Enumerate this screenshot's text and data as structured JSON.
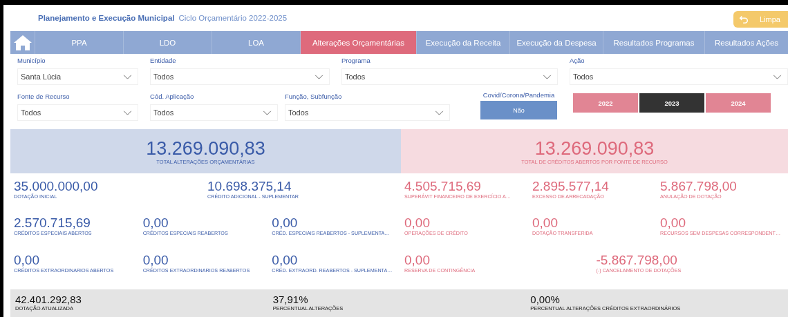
{
  "header": {
    "title": "Planejamento e Execução Municipal",
    "subtitle": "Ciclo Orçamentário 2022-2025",
    "reset_button": "Limpa"
  },
  "tabs": [
    {
      "label": "PPA",
      "selected": false
    },
    {
      "label": "LDO",
      "selected": false
    },
    {
      "label": "LOA",
      "selected": false
    },
    {
      "label": "Alterações Orçamentárias",
      "selected": true
    },
    {
      "label": "Execução da Receita",
      "selected": false
    },
    {
      "label": "Execução da Despesa",
      "selected": false
    },
    {
      "label": "Resultados Programas",
      "selected": false
    },
    {
      "label": "Resultados Ações",
      "selected": false
    }
  ],
  "filters_row1": [
    {
      "label": "Município",
      "value": "Santa Lúcia"
    },
    {
      "label": "Entidade",
      "value": "Todos"
    },
    {
      "label": "Programa",
      "value": "Todos"
    },
    {
      "label": "Ação",
      "value": "Todos"
    }
  ],
  "filters_row2": [
    {
      "label": "Fonte de Recurso",
      "value": "Todos"
    },
    {
      "label": "Cód. Aplicação",
      "value": "Todos"
    },
    {
      "label": "Função, Subfunção",
      "value": "Todos"
    }
  ],
  "covid": {
    "label": "Covid/Corona/Pandemia",
    "value": "Não"
  },
  "years": [
    {
      "label": "2022",
      "selected": false
    },
    {
      "label": "2023",
      "selected": true
    },
    {
      "label": "2024",
      "selected": false
    }
  ],
  "totals": [
    {
      "value": "13.269.090,83",
      "label": "TOTAL ALTERAÇÕES ORÇAMENTÁRIAS"
    },
    {
      "value": "13.269.090,83",
      "label": "TOTAL DE CRÉDITOS ABERTOS POR FONTE DE RECURSO"
    }
  ],
  "left_rows": [
    [
      {
        "value": "35.000.000,00",
        "label": "DOTAÇÃO INICIAL"
      },
      {
        "value": "10.698.375,14",
        "label": "CRÉDITO ADICIONAL - SUPLEMENTAR"
      }
    ],
    [
      {
        "value": "2.570.715,69",
        "label": "CRÉDITOS ESPECIAIS ABERTOS"
      },
      {
        "value": "0,00",
        "label": "CRÉDITOS ESPECIAIS REABERTOS"
      },
      {
        "value": "0,00",
        "label": "CRÉD. ESPECIAIS REABERTOS - SUPLEMENTA…"
      }
    ],
    [
      {
        "value": "0,00",
        "label": "CRÉDITOS EXTRAORDINARIOS ABERTOS"
      },
      {
        "value": "0,00",
        "label": "CRÉDITOS EXTRAORDINARIOS REABERTOS"
      },
      {
        "value": "0,00",
        "label": "CRÉD. EXTRAORD. REABERTOS - SUPLEMENTA…"
      }
    ]
  ],
  "right_rows": [
    [
      {
        "value": "4.505.715,69",
        "label": "SUPERÁVIT FINANCEIRO DE EXERCÍCIO A…"
      },
      {
        "value": "2.895.577,14",
        "label": "EXCESSO DE ARRECADAÇÃO"
      },
      {
        "value": "5.867.798,00",
        "label": "ANULAÇÃO DE DOTAÇÃO"
      }
    ],
    [
      {
        "value": "0,00",
        "label": "OPERAÇÕES DE CRÉDITO"
      },
      {
        "value": "0,00",
        "label": "DOTAÇÃO TRANSFERIDA"
      },
      {
        "value": "0,00",
        "label": "RECURSOS SEM DESPESAS CORRESPONDENT…"
      }
    ],
    [
      {
        "value": "0,00",
        "label": "RESERVA DE CONTINGÊNCIA"
      },
      {
        "value": "-5.867.798,00",
        "label": "(-) CANCELAMENTO DE DOTAÇÕES"
      }
    ]
  ],
  "summary": [
    {
      "value": "42.401.292,83",
      "label": "DOTAÇÃO ATUALIZADA"
    },
    {
      "value": "37,91%",
      "label": "PERCENTUAL ALTERAÇÕES"
    },
    {
      "value": "0,00%",
      "label": "PERCENTUAL ALTERAÇÕES CRÉDITOS EXTRAORDINÁRIOS"
    }
  ]
}
